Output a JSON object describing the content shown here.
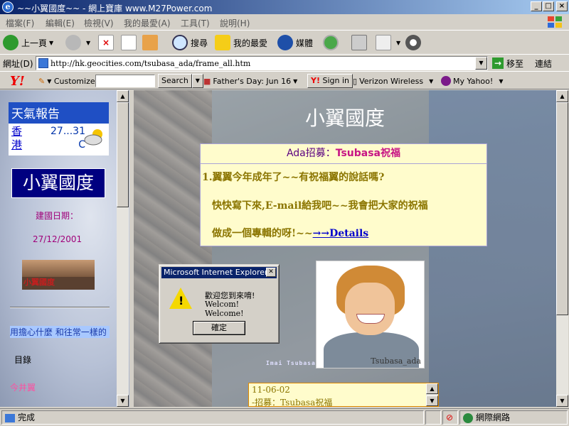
{
  "window": {
    "title": "~~小翼國度~~ - 網上寶庫 www.M27Power.com",
    "buttons": {
      "minimize": "_",
      "maximize": "□",
      "close": "×"
    }
  },
  "menu": [
    "檔案(F)",
    "編輯(E)",
    "檢視(V)",
    "我的最愛(A)",
    "工具(T)",
    "說明(H)"
  ],
  "toolbar": {
    "back": "上一頁",
    "search": "搜尋",
    "favorites": "我的最愛",
    "media": "媒體"
  },
  "address": {
    "label": "網址(D)",
    "url": "http://hk.geocities.com/tsubasa_ada/frame_all.htm",
    "go": "移至",
    "links": "連結"
  },
  "yahoo_bar": {
    "logo": "Y!",
    "customize": "Customize",
    "search_button": "Search",
    "fathers_day": "Father's Day: Jun 16",
    "signin": "Sign in",
    "verizon": "Verizon Wireless",
    "my_yahoo": "My Yahoo!"
  },
  "left_frame": {
    "weather_title": "天氣報告",
    "weather_city": "香港",
    "weather_temp": "27...31 C",
    "logo_text": "小翼國度",
    "established_label": "建國日期：",
    "established_date": "27/12/2001",
    "banner_text": "小翼國度",
    "marquee": "用擔心什麼 和往常一樣的",
    "toc": "目錄",
    "name": "今井翼"
  },
  "main_frame": {
    "site_title": "小翼國度",
    "notice": {
      "title_prefix": "Ada招募：",
      "title_highlight": "Tsubasa祝福",
      "line1": "1.翼翼今年成年了~~有祝福翼的說話嗎?",
      "line2": "快快寫下來,E-mail給我吧~~我會把大家的祝福",
      "line3": "做成一個專輯的呀!~~",
      "details": "→→Details"
    },
    "photo_caption": "Tsubasa_ada",
    "photo_tag": "Imai Tsubasa",
    "news": [
      "11-06-02",
      "-招募：Tsubasa祝福"
    ]
  },
  "dialog": {
    "title": "Microsoft Internet Explorer",
    "message_zh": "歡迎您到來唷!",
    "message_en": "Welcom! Welcome!",
    "ok": "確定"
  },
  "status": {
    "left": "完成",
    "zone": "網際網路"
  }
}
